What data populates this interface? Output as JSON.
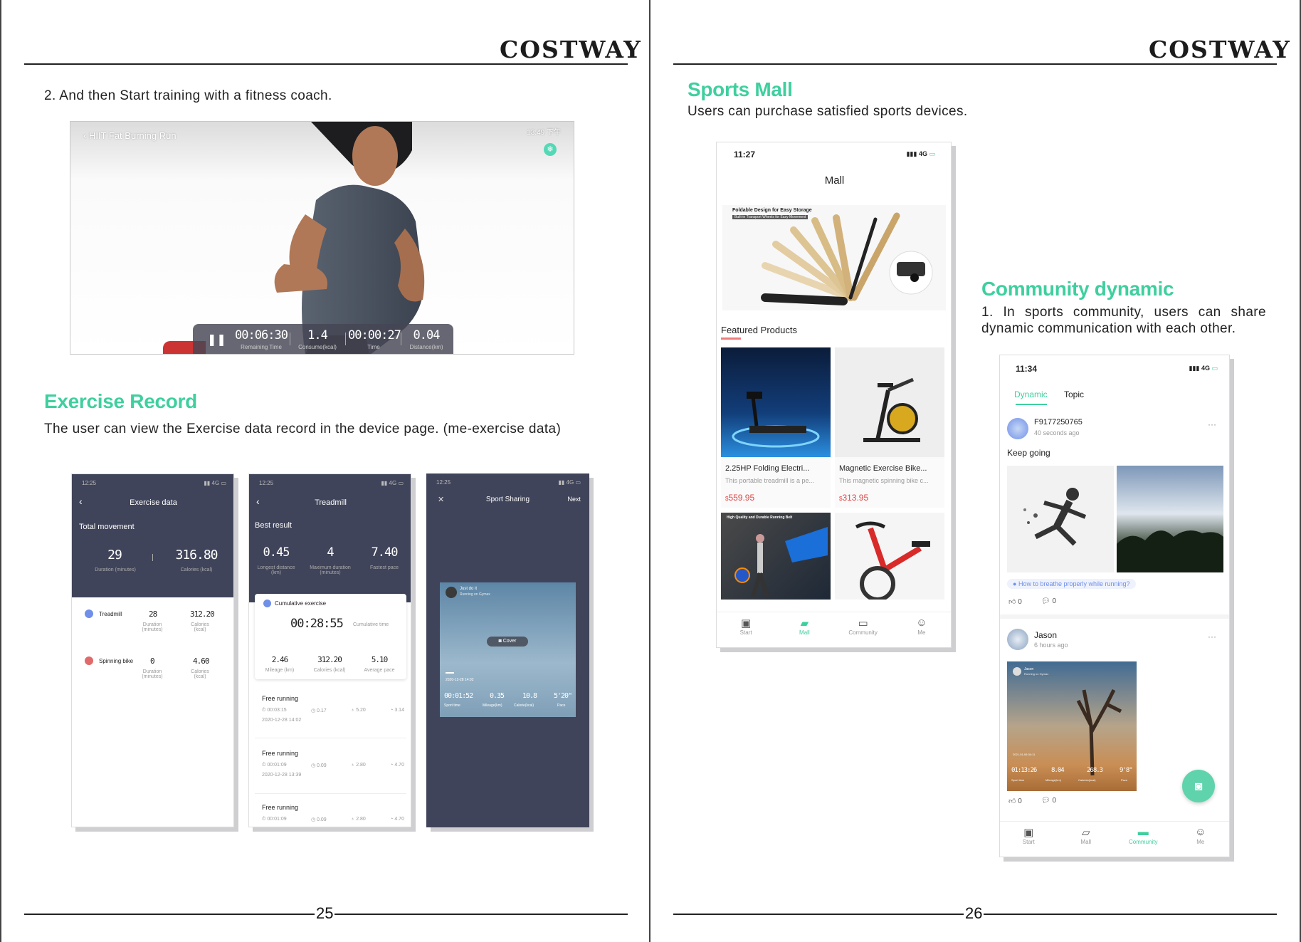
{
  "brand": "COSTWAY",
  "page25": {
    "page_number": "25",
    "step_text": "2.  And then Start training with a fitness coach.",
    "video": {
      "title": "HIIT Fat Burning Run",
      "clock": "13:49 下午",
      "stats": [
        {
          "value": "00:06:30",
          "label": "Remaining Time"
        },
        {
          "value": "1.4",
          "label": "Consume(kcal)"
        },
        {
          "value": "00:00:27",
          "label": "Time"
        },
        {
          "value": "0.04",
          "label": "Distance(km)"
        }
      ]
    },
    "exercise_heading": "Exercise Record",
    "exercise_text": "The user can view the Exercise data record in the device page. (me-exercise data)",
    "screen_a": {
      "time": "12:25",
      "title": "Exercise data",
      "subtitle": "Total movement",
      "stats": [
        {
          "value": "29",
          "label": "Duration (minutes)"
        },
        {
          "value": "316.80",
          "label": "Calories (kcal)"
        }
      ],
      "rows": [
        {
          "name": "Treadmill",
          "duration": "28",
          "duration_label": "Duration (minutes)",
          "calories": "312.20",
          "calories_label": "Calories (kcal)"
        },
        {
          "name": "Spinning bike",
          "duration": "0",
          "duration_label": "Duration (minutes)",
          "calories": "4.60",
          "calories_label": "Calories (kcal)"
        }
      ]
    },
    "screen_b": {
      "time": "12:25",
      "title": "Treadmill",
      "subtitle": "Best result",
      "best": [
        {
          "value": "0.45",
          "label": "Longest distance (km)"
        },
        {
          "value": "4",
          "label": "Maximum duration (minutes)"
        },
        {
          "value": "7.40",
          "label": "Fastest pace"
        }
      ],
      "cumulative_label": "Cumulative exercise",
      "cumulative_time": "00:28:55",
      "cumulative_time_label": "Cumulative time",
      "cumulative": [
        {
          "value": "2.46",
          "label": "Mileage (km)"
        },
        {
          "value": "312.20",
          "label": "Calories (kcal)"
        },
        {
          "value": "5.10",
          "label": "Average pace"
        }
      ],
      "records": [
        {
          "title": "Free running",
          "items": [
            "00:03:15",
            "0.17",
            "5.20",
            "3.14"
          ],
          "date": "2020-12-28 14:02"
        },
        {
          "title": "Free running",
          "items": [
            "00:01:09",
            "0.09",
            "2.80",
            "4.70"
          ],
          "date": "2020-12-28 13:39"
        },
        {
          "title": "Free running",
          "items": [
            "00:01:09",
            "0.09",
            "2.80",
            "4.70"
          ],
          "date": ""
        }
      ]
    },
    "screen_c": {
      "time": "12:25",
      "title": "Sport Sharing",
      "next": "Next",
      "card_user": "Just do it",
      "card_sub": "Running on Gymax",
      "cover_label": "Cover",
      "date": "2020-12-28 14:02",
      "stats": [
        {
          "value": "00:01:52",
          "label": "Sport time"
        },
        {
          "value": "0.35",
          "label": "Mileage(km)"
        },
        {
          "value": "10.8",
          "label": "Calorie(kcal)"
        },
        {
          "value": "5'20\"",
          "label": "Pace"
        }
      ]
    }
  },
  "page26": {
    "page_number": "26",
    "mall_heading": "Sports Mall",
    "mall_text": "Users can purchase satisfied sports devices.",
    "mall": {
      "time": "11:27",
      "signal": "4G",
      "title": "Mall",
      "banner_title": "Foldable Design for Easy Storage",
      "banner_sub": "Built-in Transport Wheels for Easy Movement",
      "featured_label": "Featured Products",
      "products": [
        {
          "name": "2.25HP Folding Electri...",
          "desc": "This portable treadmill is a pe...",
          "price": "559.95"
        },
        {
          "name": "Magnetic Exercise Bike...",
          "desc": "This magnetic spinning bike c...",
          "price": "313.95"
        }
      ],
      "currency": "$",
      "promo_title": "High Quality and Durable Running Belt",
      "tabs": [
        "Start",
        "Mall",
        "Community",
        "Me"
      ]
    },
    "community_heading": "Community dynamic",
    "community_text": "1. In sports community, users can share dynamic communication with each other.",
    "community": {
      "time": "11:34",
      "signal": "4G",
      "tab_dynamic": "Dynamic",
      "tab_topic": "Topic",
      "post1": {
        "user": "F9177250765",
        "time": "40 seconds ago",
        "text": "Keep going",
        "topic": "How to breathe properly while running?",
        "likes": "0",
        "comments": "0"
      },
      "post2": {
        "user": "Jason",
        "time": "6 hours ago",
        "card_user": "Jason",
        "card_sub": "Running on Gymax",
        "date": "2021-01-06 04:11",
        "stats": [
          {
            "value": "01:13:26",
            "label": "Sport time"
          },
          {
            "value": "8.04",
            "label": "Mileage(km)"
          },
          {
            "value": "268.3",
            "label": "Calories(kcal)"
          },
          {
            "value": "9'8\"",
            "label": "Pace"
          }
        ],
        "likes": "0",
        "comments": "0"
      },
      "tabs": [
        "Start",
        "Mall",
        "Community",
        "Me"
      ]
    }
  }
}
